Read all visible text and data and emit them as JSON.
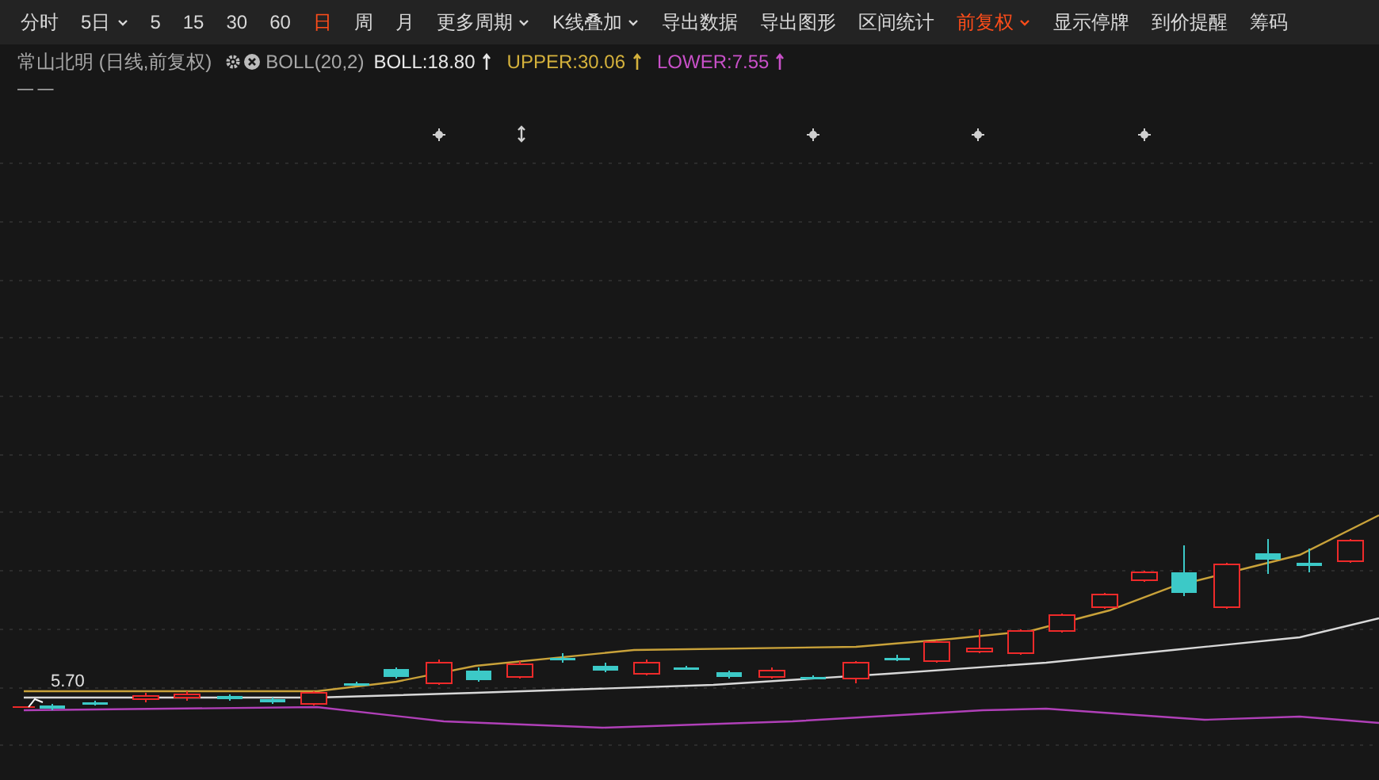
{
  "toolbar": [
    {
      "label": "分时",
      "selected": false,
      "dropdown": false
    },
    {
      "label": "5日",
      "selected": false,
      "dropdown": true
    },
    {
      "label": "5",
      "selected": false,
      "dropdown": false
    },
    {
      "label": "15",
      "selected": false,
      "dropdown": false
    },
    {
      "label": "30",
      "selected": false,
      "dropdown": false
    },
    {
      "label": "60",
      "selected": false,
      "dropdown": false
    },
    {
      "label": "日",
      "selected": true,
      "dropdown": false
    },
    {
      "label": "周",
      "selected": false,
      "dropdown": false
    },
    {
      "label": "月",
      "selected": false,
      "dropdown": false
    },
    {
      "label": "更多周期",
      "selected": false,
      "dropdown": true
    },
    {
      "label": "K线叠加",
      "selected": false,
      "dropdown": true
    },
    {
      "label": "导出数据",
      "selected": false,
      "dropdown": false
    },
    {
      "label": "导出图形",
      "selected": false,
      "dropdown": false
    },
    {
      "label": "区间统计",
      "selected": false,
      "dropdown": false
    },
    {
      "label": "前复权",
      "selected": true,
      "dropdown": true
    },
    {
      "label": "显示停牌",
      "selected": false,
      "dropdown": false
    },
    {
      "label": "到价提醒",
      "selected": false,
      "dropdown": false
    },
    {
      "label": "筹码",
      "selected": false,
      "dropdown": false
    }
  ],
  "info": {
    "title": "常山北明 (日线,前复权)",
    "indicator": "BOLL(20,2)",
    "values": [
      {
        "label": "BOLL:18.80",
        "color": "#e8e8e8"
      },
      {
        "label": "UPPER:30.06",
        "color": "#d4b13c"
      },
      {
        "label": "LOWER:7.55",
        "color": "#c850c8"
      }
    ]
  },
  "legend": "— —",
  "chart": {
    "low_label": "5.70",
    "events": [
      {
        "kind": "star"
      },
      {
        "kind": "split"
      },
      {
        "kind": "star"
      },
      {
        "kind": "star"
      },
      {
        "kind": "star"
      }
    ]
  }
}
